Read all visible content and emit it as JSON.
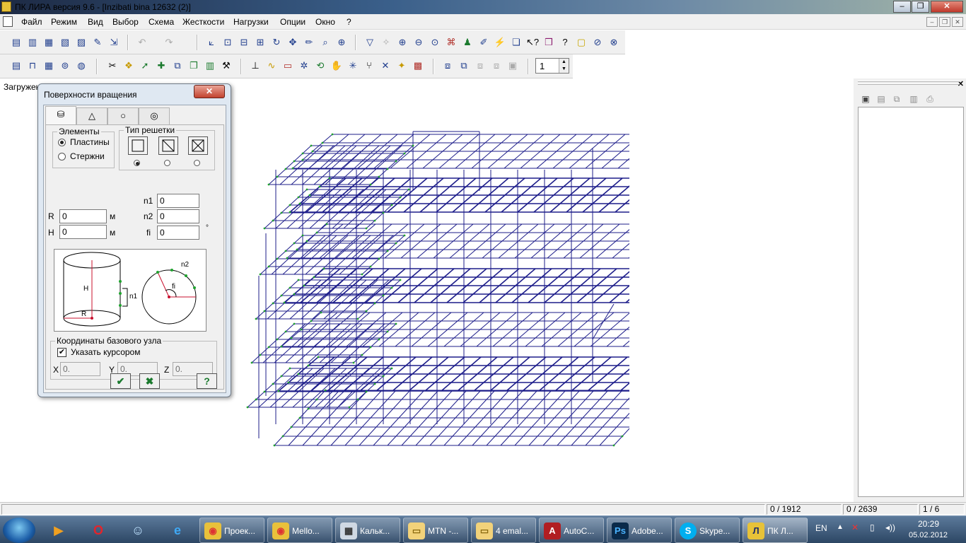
{
  "window": {
    "title": "ПК ЛИРА  версия 9.6 - [Inzibati bina 12632 (2)]"
  },
  "menu": [
    "Файл",
    "Режим",
    "Вид",
    "Выбор",
    "Схема",
    "Жесткости",
    "Нагрузки",
    "Опции",
    "Окно",
    "?"
  ],
  "toolbar2": {
    "spin_value": "1"
  },
  "workspace": {
    "label": "Загружен"
  },
  "dialog": {
    "title": "Поверхности вращения",
    "tabs": [
      "cylinder-icon",
      "cone-icon",
      "circle-icon",
      "torus-icon"
    ],
    "elements_group": "Элементы",
    "radio_plates": "Пластины",
    "radio_rods": "Стержни",
    "grid_group": "Тип решетки",
    "label_R": "R",
    "label_H": "H",
    "R_value": "0",
    "H_value": "0",
    "unit_m1": "м",
    "unit_m2": "м",
    "label_n1": "n1",
    "label_n2": "n2",
    "label_fi": "fi",
    "n1_value": "0",
    "n2_value": "0",
    "fi_value": "0",
    "deg_unit": "°",
    "schema_H": "H",
    "schema_R": "R",
    "schema_n1": "n1",
    "schema_n2": "n2",
    "schema_fi": "fi",
    "coords_group": "Координаты базового узла",
    "cursor_checkbox": "Указать курсором",
    "label_X": "X",
    "label_Y": "Y",
    "label_Z": "Z",
    "X_value": "0.",
    "Y_value": "0.",
    "Z_value": "0."
  },
  "statusbar": {
    "nodes": "0 / 1912",
    "elements": "0 / 2639",
    "page": "1 / 6"
  },
  "taskbar": {
    "tasks": [
      "Проек...",
      "Mello...",
      "Кальк...",
      "MTN -...",
      "4 emal...",
      "AutoC...",
      "Adobe...",
      "Skype...",
      "ПК Л..."
    ],
    "lang": "EN",
    "time": "20:29",
    "date": "05.02.2012"
  }
}
